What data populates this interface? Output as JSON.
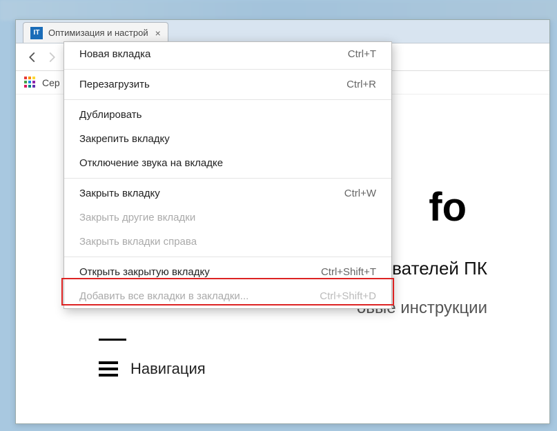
{
  "tab": {
    "favicon_text": "IT",
    "title": "Оптимизация и настрой"
  },
  "bookmarks": {
    "apps_label": "Сер"
  },
  "page": {
    "site_title_fragment": "fo",
    "subtitle1_fragment": "ьзователей ПК",
    "subtitle2_fragment": "овые инструкции",
    "nav_label": "Навигация"
  },
  "menu": {
    "items": [
      {
        "label": "Новая вкладка",
        "shortcut": "Ctrl+T",
        "disabled": false
      },
      {
        "sep": true
      },
      {
        "label": "Перезагрузить",
        "shortcut": "Ctrl+R",
        "disabled": false
      },
      {
        "sep": true
      },
      {
        "label": "Дублировать",
        "shortcut": "",
        "disabled": false
      },
      {
        "label": "Закрепить вкладку",
        "shortcut": "",
        "disabled": false
      },
      {
        "label": "Отключение звука на вкладке",
        "shortcut": "",
        "disabled": false
      },
      {
        "sep": true
      },
      {
        "label": "Закрыть вкладку",
        "shortcut": "Ctrl+W",
        "disabled": false
      },
      {
        "label": "Закрыть другие вкладки",
        "shortcut": "",
        "disabled": true
      },
      {
        "label": "Закрыть вкладки справа",
        "shortcut": "",
        "disabled": true
      },
      {
        "sep": true
      },
      {
        "label": "Открыть закрытую вкладку",
        "shortcut": "Ctrl+Shift+T",
        "disabled": false
      },
      {
        "label": "Добавить все вкладки в закладки...",
        "shortcut": "Ctrl+Shift+D",
        "disabled": true
      }
    ]
  }
}
